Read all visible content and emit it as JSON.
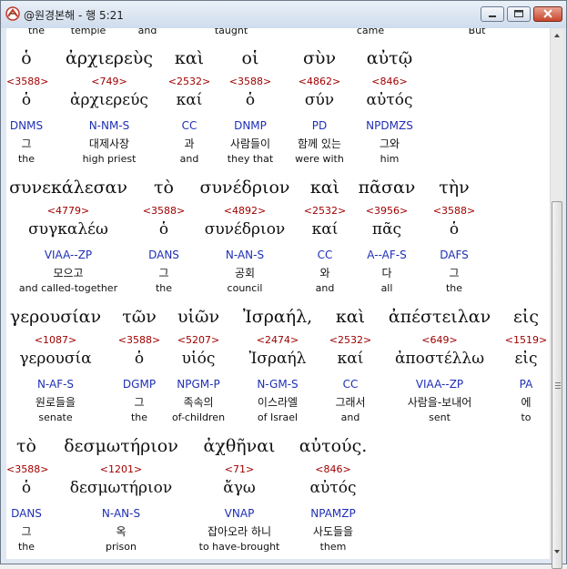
{
  "window": {
    "title": "@원경본해 - 행 5:21"
  },
  "top_glosses": [
    "the",
    "temple",
    "and",
    "taught",
    "came",
    "But"
  ],
  "blocks": [
    {
      "words": [
        {
          "greek": "ὁ",
          "strong": "<3588>",
          "lemma": "ὁ",
          "parsing": "DNMS",
          "korean": "그",
          "english": "the"
        },
        {
          "greek": "ἀρχιερεὺς",
          "strong": "<749>",
          "lemma": "ἀρχιερεύς",
          "parsing": "N-NM-S",
          "korean": "대제사장",
          "english": "high priest"
        },
        {
          "greek": "καὶ",
          "strong": "<2532>",
          "lemma": "καί",
          "parsing": "CC",
          "korean": "과",
          "english": "and"
        },
        {
          "greek": "οἱ",
          "strong": "<3588>",
          "lemma": "ὁ",
          "parsing": "DNMP",
          "korean": "사람들이",
          "english": "they that"
        },
        {
          "greek": "σὺν",
          "strong": "<4862>",
          "lemma": "σύν",
          "parsing": "PD",
          "korean": "함께 있는",
          "english": "were with"
        },
        {
          "greek": "αὐτῷ",
          "strong": "<846>",
          "lemma": "αὐτός",
          "parsing": "NPDMZS",
          "korean": "그와",
          "english": "him"
        }
      ]
    },
    {
      "words": [
        {
          "greek": "συνεκάλεσαν",
          "strong": "<4779>",
          "lemma": "συγκαλέω",
          "parsing": "VIAA--ZP",
          "korean": "모으고",
          "english": "and called-together"
        },
        {
          "greek": "τὸ",
          "strong": "<3588>",
          "lemma": "ὁ",
          "parsing": "DANS",
          "korean": "그",
          "english": "the"
        },
        {
          "greek": "συνέδριον",
          "strong": "<4892>",
          "lemma": "συνέδριον",
          "parsing": "N-AN-S",
          "korean": "공회",
          "english": "council"
        },
        {
          "greek": "καὶ",
          "strong": "<2532>",
          "lemma": "καί",
          "parsing": "CC",
          "korean": "와",
          "english": "and"
        },
        {
          "greek": "πᾶσαν",
          "strong": "<3956>",
          "lemma": "πᾶς",
          "parsing": "A--AF-S",
          "korean": "다",
          "english": "all"
        },
        {
          "greek": "τὴν",
          "strong": "<3588>",
          "lemma": "ὁ",
          "parsing": "DAFS",
          "korean": "그",
          "english": "the"
        }
      ]
    },
    {
      "words": [
        {
          "greek": "γερουσίαν",
          "strong": "<1087>",
          "lemma": "γερουσία",
          "parsing": "N-AF-S",
          "korean": "원로들을",
          "english": "senate"
        },
        {
          "greek": "τῶν",
          "strong": "<3588>",
          "lemma": "ὁ",
          "parsing": "DGMP",
          "korean": "그",
          "english": "the"
        },
        {
          "greek": "υἱῶν",
          "strong": "<5207>",
          "lemma": "υἱός",
          "parsing": "NPGM-P",
          "korean": "족속의",
          "english": "of-children"
        },
        {
          "greek": "Ἰσραήλ,",
          "strong": "<2474>",
          "lemma": "Ἰσραήλ",
          "parsing": "N-GM-S",
          "korean": "이스라엘",
          "english": "of Israel"
        },
        {
          "greek": "καὶ",
          "strong": "<2532>",
          "lemma": "καί",
          "parsing": "CC",
          "korean": "그래서",
          "english": "and"
        },
        {
          "greek": "ἀπέστειλαν",
          "strong": "<649>",
          "lemma": "ἀποστέλλω",
          "parsing": "VIAA--ZP",
          "korean": "사람을-보내어",
          "english": "sent"
        },
        {
          "greek": "εἰς",
          "strong": "<1519>",
          "lemma": "εἰς",
          "parsing": "PA",
          "korean": "에",
          "english": "to"
        }
      ]
    },
    {
      "words": [
        {
          "greek": "τὸ",
          "strong": "<3588>",
          "lemma": "ὁ",
          "parsing": "DANS",
          "korean": "그",
          "english": "the"
        },
        {
          "greek": "δεσμωτήριον",
          "strong": "<1201>",
          "lemma": "δεσμωτήριον",
          "parsing": "N-AN-S",
          "korean": "옥",
          "english": "prison"
        },
        {
          "greek": "ἀχθῆναι",
          "strong": "<71>",
          "lemma": "ἄγω",
          "parsing": "VNAP",
          "korean": "잡아오라 하니",
          "english": "to have-brought"
        },
        {
          "greek": "αὐτούς.",
          "strong": "<846>",
          "lemma": "αὐτός",
          "parsing": "NPAMZP",
          "korean": "사도들을",
          "english": "them"
        }
      ]
    }
  ],
  "icons": {
    "app": "app-logo-icon",
    "minimize": "minimize-icon",
    "maximize": "maximize-icon",
    "close": "close-icon",
    "scroll_up": "scroll-up-arrow-icon",
    "scroll_down": "scroll-down-arrow-icon"
  },
  "colors": {
    "strong_number": "#a00000",
    "parsing": "#1f2fb5",
    "text": "#111111"
  }
}
